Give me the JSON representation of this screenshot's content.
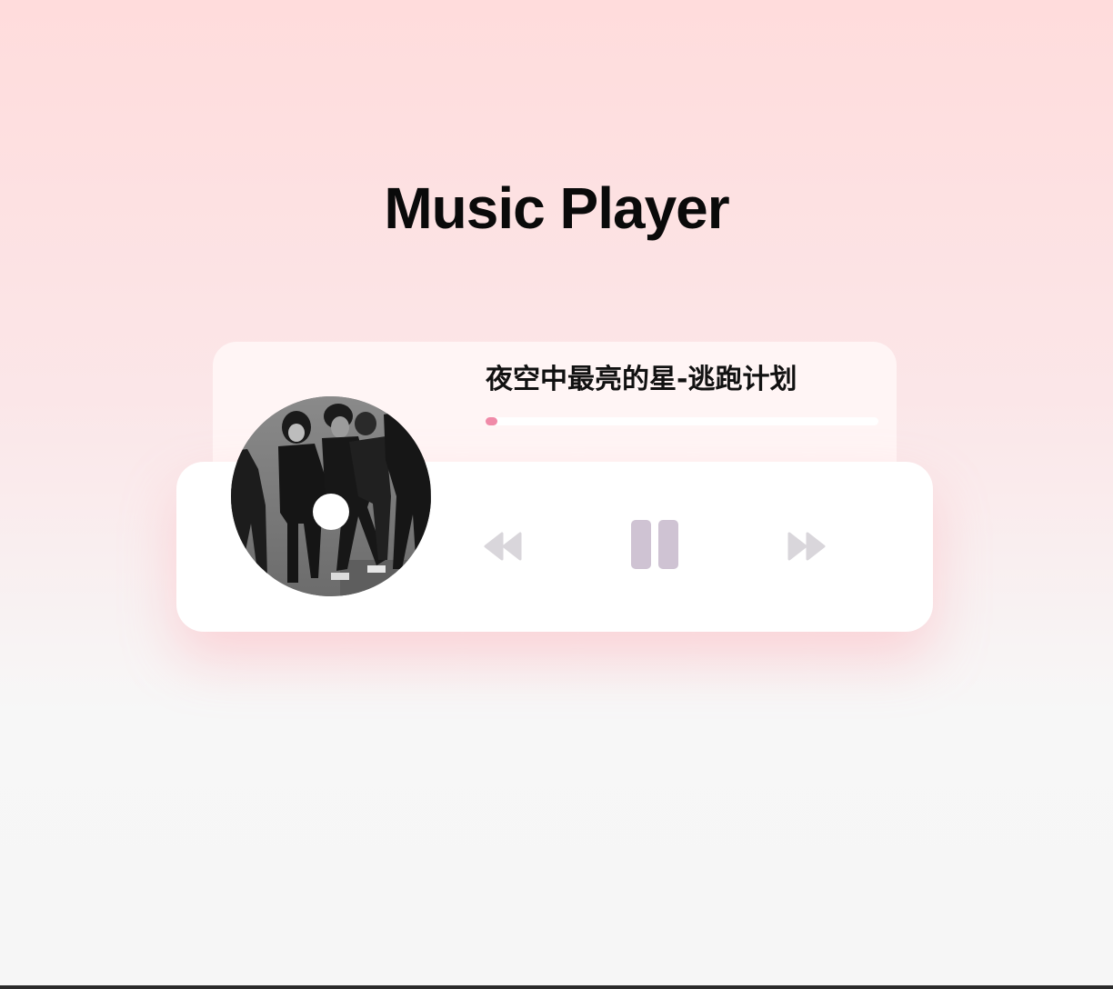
{
  "page": {
    "title": "Music Player"
  },
  "player": {
    "song_title": "夜空中最亮的星-逃跑计划",
    "progress": 0.03,
    "state": "playing",
    "album_art": "band-photo-disc",
    "controls": {
      "previous_icon": "rewind-icon",
      "play_pause_icon": "pause-icon",
      "next_icon": "fast-forward-icon"
    }
  },
  "colors": {
    "progress_fill": "#f08aa8",
    "icon_color": "#cfc3d3",
    "skip_icon_color": "#d9d6db"
  }
}
